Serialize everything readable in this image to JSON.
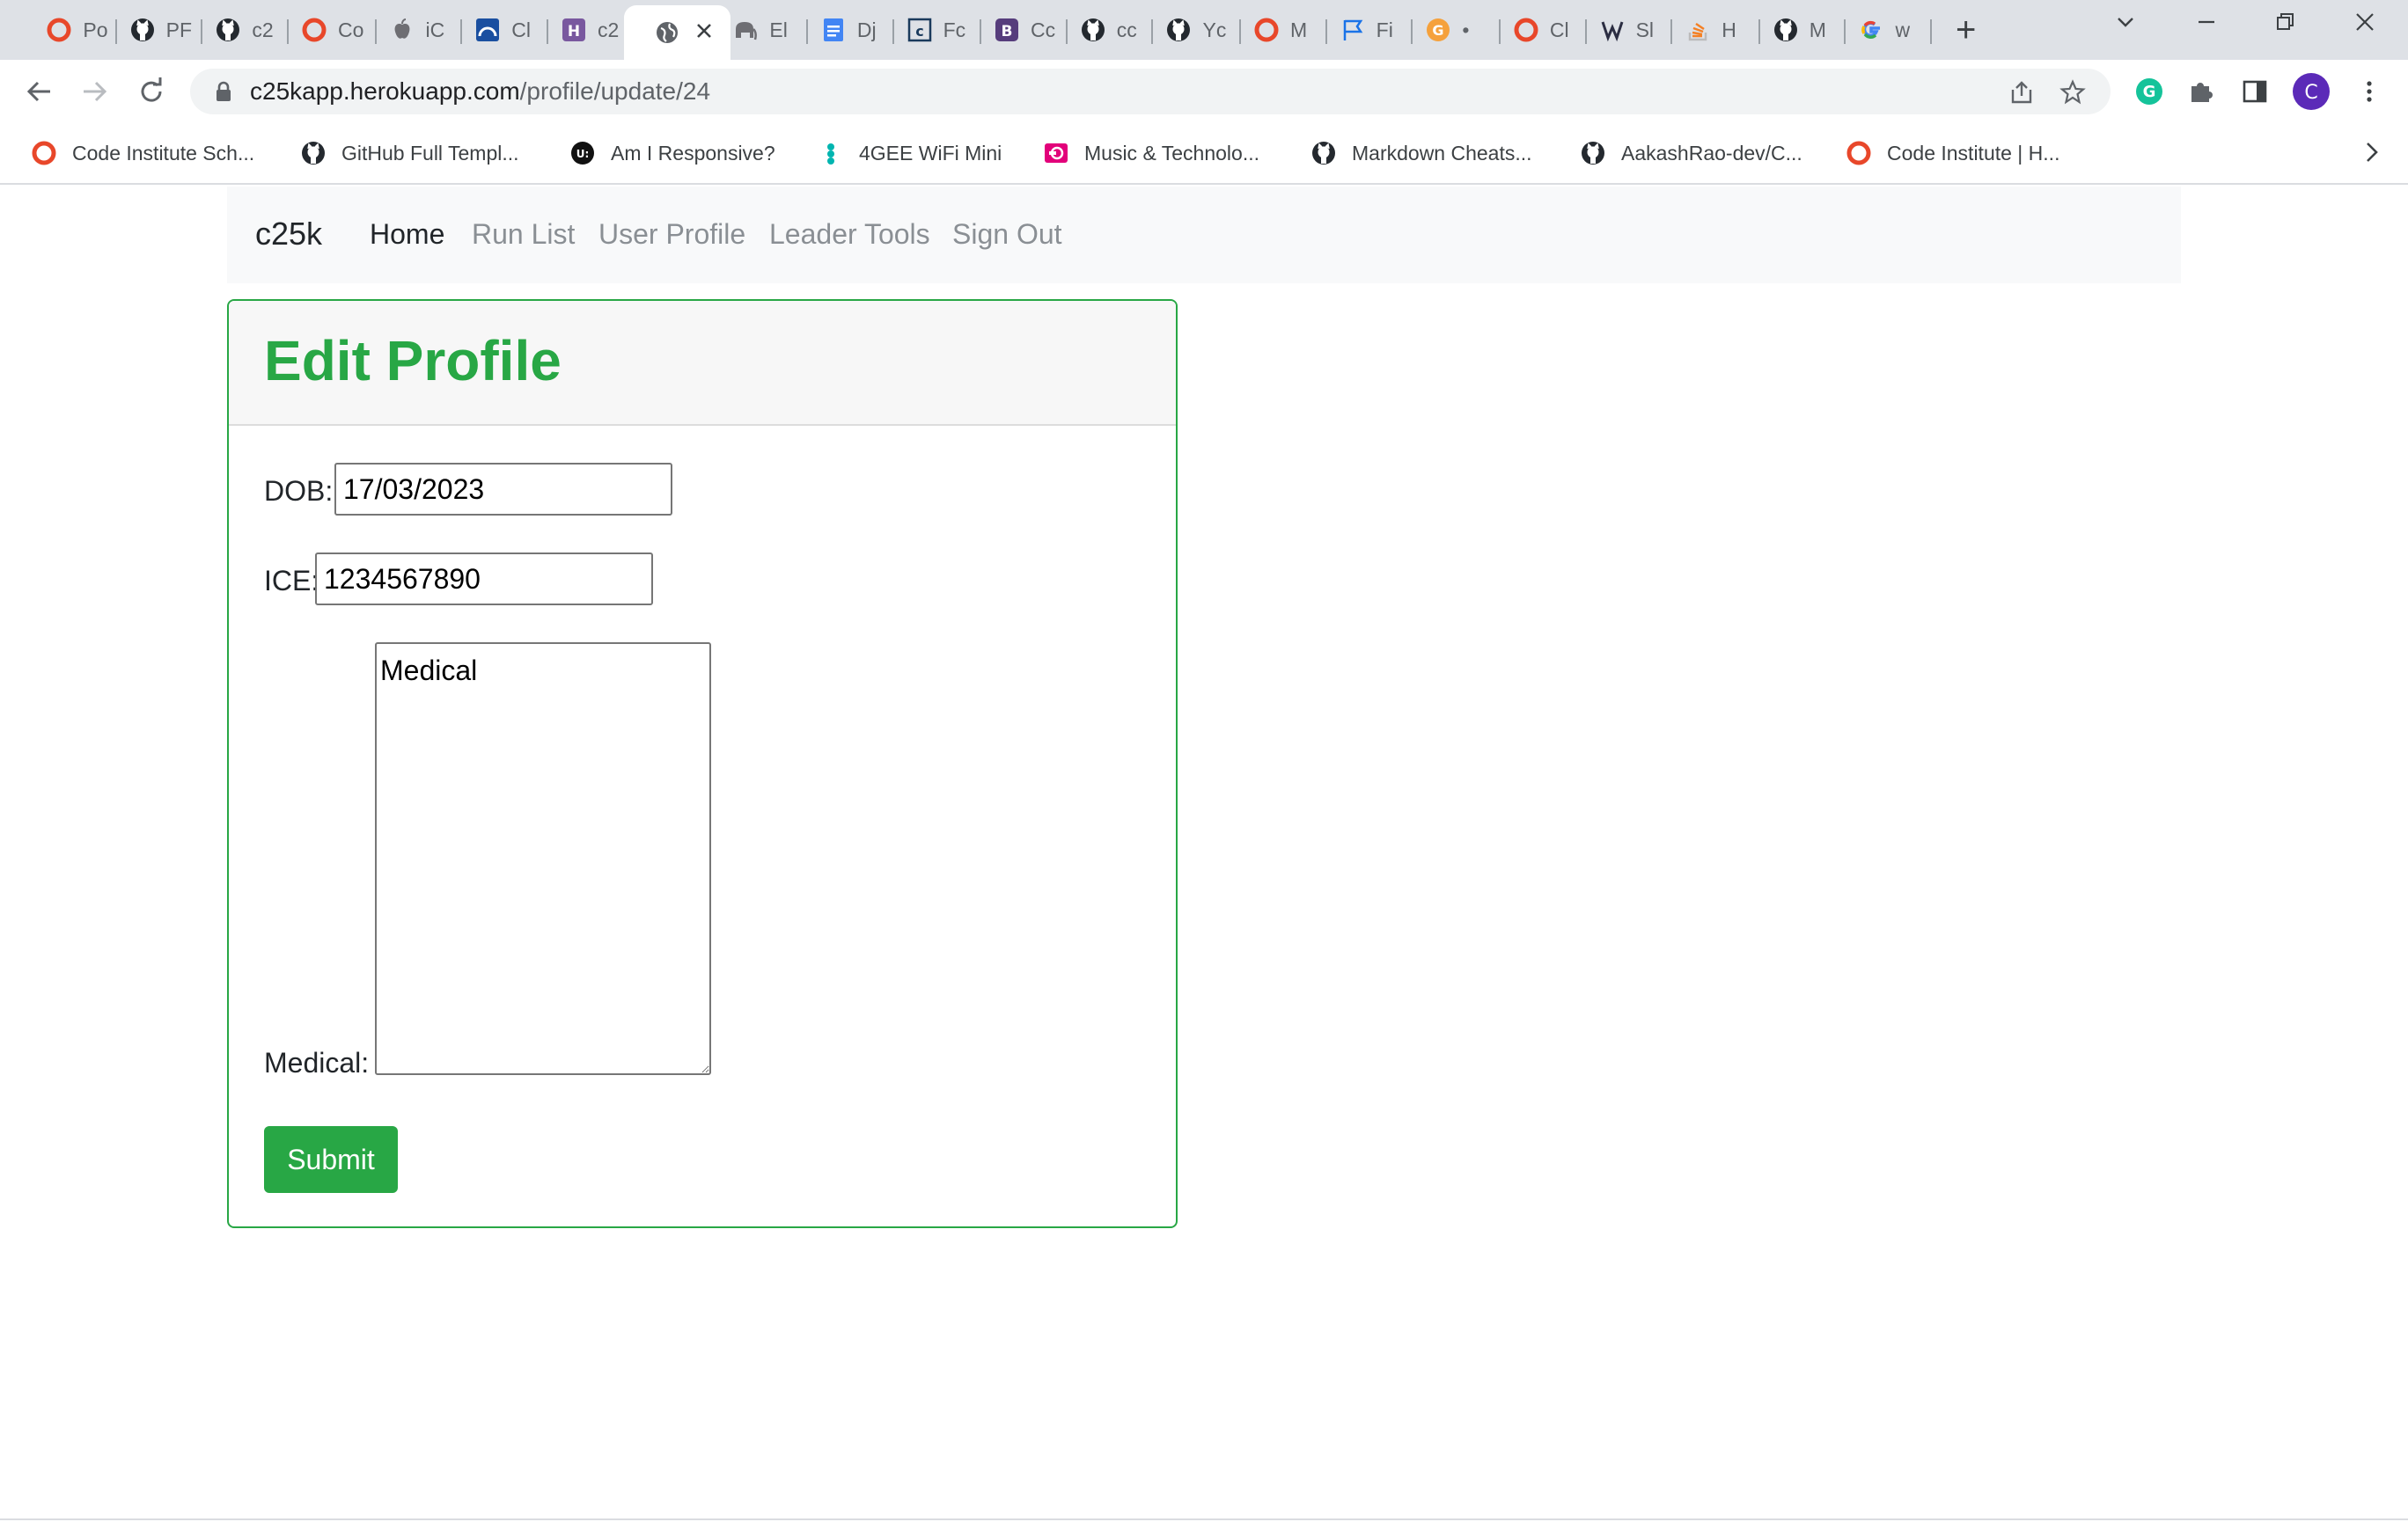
{
  "tabs": [
    {
      "label": "Po",
      "icon": "code-institute-icon"
    },
    {
      "label": "PF",
      "icon": "github-icon"
    },
    {
      "label": "c2",
      "icon": "github-icon"
    },
    {
      "label": "Co",
      "icon": "code-institute-icon"
    },
    {
      "label": "iC",
      "icon": "apple-icon"
    },
    {
      "label": "Cl",
      "icon": "chart-icon"
    },
    {
      "label": "c2",
      "icon": "heroku-icon"
    },
    {
      "label": "",
      "icon": "globe-icon",
      "active": true
    },
    {
      "label": "El",
      "icon": "elephant-icon"
    },
    {
      "label": "Dj",
      "icon": "google-docs-icon"
    },
    {
      "label": "Fc",
      "icon": "docs-icon"
    },
    {
      "label": "Cc",
      "icon": "bootstrap-icon"
    },
    {
      "label": "cc",
      "icon": "github-icon"
    },
    {
      "label": "Yc",
      "icon": "github-icon"
    },
    {
      "label": "M",
      "icon": "code-institute-icon"
    },
    {
      "label": "Fi",
      "icon": "flag-icon"
    },
    {
      "label": "•",
      "icon": "grammarly-g-icon"
    },
    {
      "label": "Cl",
      "icon": "code-institute-icon"
    },
    {
      "label": "Sl",
      "icon": "hamburger-icon"
    },
    {
      "label": "H",
      "icon": "stackoverflow-icon"
    },
    {
      "label": "M",
      "icon": "github-icon"
    },
    {
      "label": "w",
      "icon": "google-icon"
    }
  ],
  "toolbar": {
    "url_host": "c25kapp.herokuapp.com",
    "url_path": "/profile/update/24",
    "profile_initial": "C"
  },
  "bookmarks": [
    {
      "label": "Code Institute Sch...",
      "icon": "code-institute-icon"
    },
    {
      "label": "GitHub Full Templ...",
      "icon": "github-icon"
    },
    {
      "label": "Am I Responsive?",
      "icon": "ui-icon"
    },
    {
      "label": "4GEE WiFi Mini",
      "icon": "ee-icon"
    },
    {
      "label": "Music & Technolo...",
      "icon": "music-icon"
    },
    {
      "label": "Markdown Cheats...",
      "icon": "github-icon"
    },
    {
      "label": "AakashRao-dev/C...",
      "icon": "github-icon"
    },
    {
      "label": "Code Institute | H...",
      "icon": "code-institute-icon"
    }
  ],
  "navbar": {
    "brand": "c25k",
    "links": [
      "Home",
      "Run List",
      "User Profile",
      "Leader Tools",
      "Sign Out"
    ]
  },
  "form": {
    "title": "Edit Profile",
    "dob_label": "DOB:",
    "dob_value": "17/03/2023",
    "ice_label": "ICE:",
    "ice_value": "1234567890",
    "medical_label": "Medical:",
    "medical_value": "Medical",
    "submit_label": "Submit"
  },
  "colors": {
    "accent_green": "#28a745",
    "tabstrip_bg": "#dee1e6",
    "profile_purple": "#5b2ab8"
  }
}
